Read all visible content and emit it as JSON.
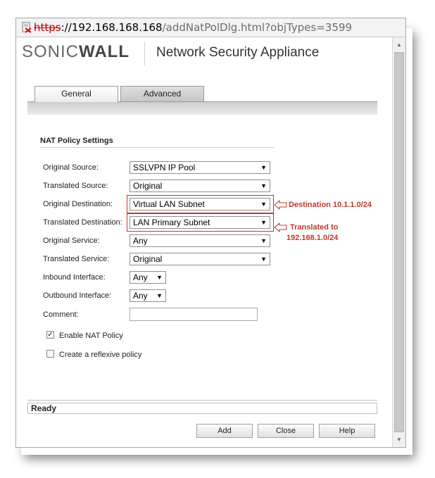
{
  "address_bar": {
    "scheme": "https",
    "host": "://192.168.168.168",
    "path": "/addNatPolDlg.html?objTypes=3599"
  },
  "header": {
    "brand_light": "SONIC",
    "brand_bold": "WALL",
    "product_name": "Network Security Appliance"
  },
  "tabs": [
    {
      "label": "General",
      "active": true
    },
    {
      "label": "Advanced",
      "active": false
    }
  ],
  "section": {
    "title": "NAT Policy Settings"
  },
  "fields": {
    "original_source": {
      "label": "Original Source:",
      "value": "SSLVPN IP Pool"
    },
    "translated_source": {
      "label": "Translated Source:",
      "value": "Original"
    },
    "original_destination": {
      "label": "Original Destination:",
      "value": "Virtual LAN Subnet"
    },
    "translated_destination": {
      "label": "Translated Destination:",
      "value": "LAN Primary Subnet"
    },
    "original_service": {
      "label": "Original Service:",
      "value": "Any"
    },
    "translated_service": {
      "label": "Translated Service:",
      "value": "Original"
    },
    "inbound_interface": {
      "label": "Inbound Interface:",
      "value": "Any"
    },
    "outbound_interface": {
      "label": "Outbound Interface:",
      "value": "Any"
    },
    "comment": {
      "label": "Comment:",
      "value": ""
    }
  },
  "checkboxes": {
    "enable_nat": {
      "label": "Enable NAT Policy",
      "checked": true
    },
    "reflexive": {
      "label": "Create a reflexive policy",
      "checked": false
    }
  },
  "annotations": {
    "destination": "Destination 10.1.1.0/24",
    "translated_line1": "Translated to",
    "translated_line2": "192.168.1.0/24"
  },
  "status": {
    "text": "Ready"
  },
  "buttons": {
    "add": "Add",
    "close": "Close",
    "help": "Help"
  },
  "colors": {
    "annotation": "#c0392b",
    "url_scheme": "#c00000"
  },
  "icons": {
    "caret": "▼",
    "scroll_up": "▲",
    "scroll_down": "▼",
    "check": "✓"
  }
}
